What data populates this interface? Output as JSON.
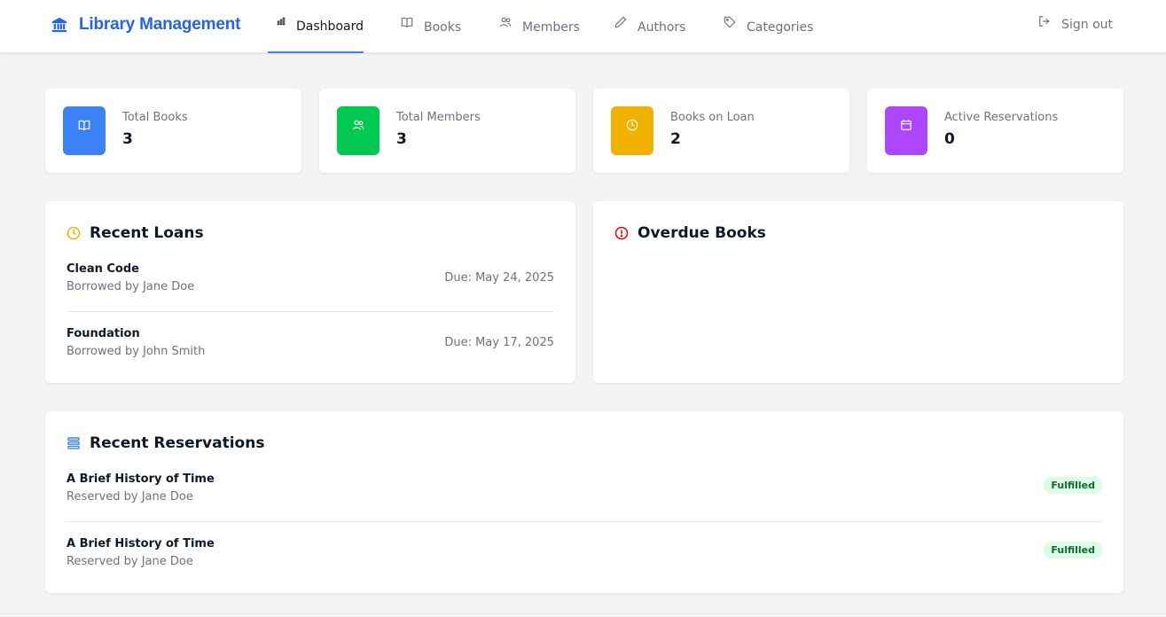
{
  "brand": {
    "title": "Library Management",
    "color": "#2563eb"
  },
  "nav": {
    "tabs": [
      {
        "label": "Dashboard",
        "icon": "chart-bar-icon",
        "active": true
      },
      {
        "label": "Books",
        "icon": "book-open-icon",
        "active": false
      },
      {
        "label": "Members",
        "icon": "users-icon",
        "active": false
      },
      {
        "label": "Authors",
        "icon": "pencil-icon",
        "active": false
      },
      {
        "label": "Categories",
        "icon": "tag-icon",
        "active": false
      }
    ],
    "signout": "Sign out"
  },
  "stats": [
    {
      "label": "Total Books",
      "value": "3",
      "icon": "book-open-icon",
      "color": "#3b82f6"
    },
    {
      "label": "Total Members",
      "value": "3",
      "icon": "users-icon",
      "color": "#00c950"
    },
    {
      "label": "Books on Loan",
      "value": "2",
      "icon": "clock-icon",
      "color": "#f0b100"
    },
    {
      "label": "Active Reservations",
      "value": "0",
      "icon": "calendar-icon",
      "color": "#ad46ff"
    }
  ],
  "recent_loans": {
    "title": "Recent Loans",
    "items": [
      {
        "title": "Clean Code",
        "sub": "Borrowed by Jane Doe",
        "due": "Due: May 24, 2025"
      },
      {
        "title": "Foundation",
        "sub": "Borrowed by John Smith",
        "due": "Due: May 17, 2025"
      }
    ]
  },
  "overdue": {
    "title": "Overdue Books",
    "items": []
  },
  "recent_reservations": {
    "title": "Recent Reservations",
    "items": [
      {
        "title": "A Brief History of Time",
        "sub": "Reserved by Jane Doe",
        "status": "Fulfilled"
      },
      {
        "title": "A Brief History of Time",
        "sub": "Reserved by Jane Doe",
        "status": "Fulfilled"
      }
    ]
  },
  "colors": {
    "accent": "#3b82f6",
    "warning": "#f0b100",
    "danger": "#e7000b",
    "success_bg": "#dcfce7",
    "success_text": "#166534"
  }
}
